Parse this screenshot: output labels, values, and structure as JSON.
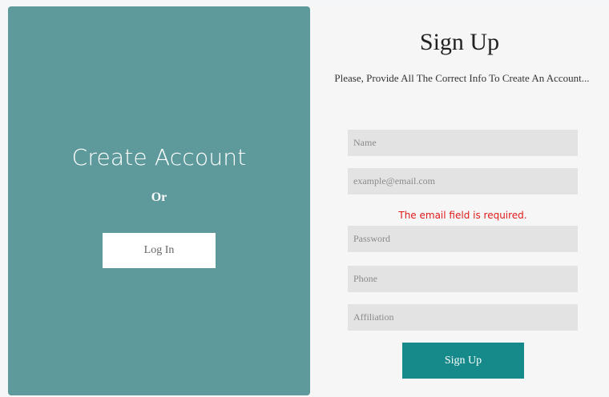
{
  "left": {
    "title": "Create Account",
    "or_text": "Or",
    "login_label": "Log In"
  },
  "right": {
    "title": "Sign Up",
    "subtitle": "Please, Provide All The Correct Info To Create An Account...",
    "fields": {
      "name_placeholder": "Name",
      "email_placeholder": "example@email.com",
      "password_placeholder": "Password",
      "phone_placeholder": "Phone",
      "affiliation_placeholder": "Affiliation"
    },
    "error_message": "The email field is required.",
    "signup_label": "Sign Up"
  },
  "colors": {
    "left_panel": "#5e9a9b",
    "signup_button": "#168a8a",
    "error": "#e01919"
  }
}
